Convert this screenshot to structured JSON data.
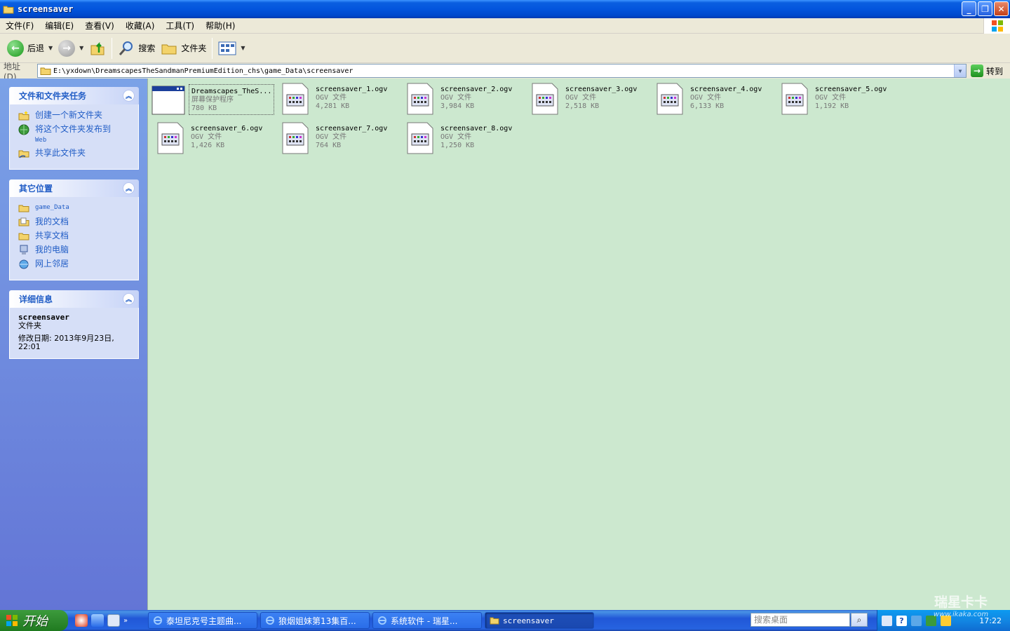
{
  "window": {
    "title": "screensaver",
    "icon": "folder-icon"
  },
  "menu": [
    "文件(F)",
    "编辑(E)",
    "查看(V)",
    "收藏(A)",
    "工具(T)",
    "帮助(H)"
  ],
  "toolbar": {
    "back_label": "后退",
    "search_label": "搜索",
    "folders_label": "文件夹"
  },
  "address": {
    "label": "地址(D)",
    "path": "E:\\yxdown\\DreamscapesTheSandmanPremiumEdition_chs\\game_Data\\screensaver",
    "go_label": "转到"
  },
  "tasks_panel": {
    "title": "文件和文件夹任务",
    "items": [
      {
        "label": "创建一个新文件夹",
        "icon": "new-folder-icon"
      },
      {
        "label": "将这个文件夹发布到",
        "label2": "Web",
        "icon": "publish-web-icon"
      },
      {
        "label": "共享此文件夹",
        "icon": "share-folder-icon"
      }
    ]
  },
  "places_panel": {
    "title": "其它位置",
    "items": [
      {
        "label": "game_Data",
        "icon": "folder-icon"
      },
      {
        "label": "我的文档",
        "icon": "my-documents-icon"
      },
      {
        "label": "共享文档",
        "icon": "shared-documents-icon"
      },
      {
        "label": "我的电脑",
        "icon": "my-computer-icon"
      },
      {
        "label": "网上邻居",
        "icon": "network-places-icon"
      }
    ]
  },
  "details_panel": {
    "title": "详细信息",
    "name": "screensaver",
    "type": "文件夹",
    "modified_line1": "修改日期: 2013年9月23日,",
    "modified_line2": "22:01"
  },
  "files": [
    {
      "name": "Dreamscapes_TheS...",
      "type": "屏幕保护程序",
      "size": "780 KB",
      "icon": "screensaver-icon",
      "selected": true
    },
    {
      "name": "screensaver_1.ogv",
      "type": "OGV 文件",
      "size": "4,281 KB",
      "icon": "media-file-icon"
    },
    {
      "name": "screensaver_2.ogv",
      "type": "OGV 文件",
      "size": "3,984 KB",
      "icon": "media-file-icon"
    },
    {
      "name": "screensaver_3.ogv",
      "type": "OGV 文件",
      "size": "2,518 KB",
      "icon": "media-file-icon"
    },
    {
      "name": "screensaver_4.ogv",
      "type": "OGV 文件",
      "size": "6,133 KB",
      "icon": "media-file-icon"
    },
    {
      "name": "screensaver_5.ogv",
      "type": "OGV 文件",
      "size": "1,192 KB",
      "icon": "media-file-icon"
    },
    {
      "name": "screensaver_6.ogv",
      "type": "OGV 文件",
      "size": "1,426 KB",
      "icon": "media-file-icon"
    },
    {
      "name": "screensaver_7.ogv",
      "type": "OGV 文件",
      "size": "764 KB",
      "icon": "media-file-icon"
    },
    {
      "name": "screensaver_8.ogv",
      "type": "OGV 文件",
      "size": "1,250 KB",
      "icon": "media-file-icon"
    }
  ],
  "taskbar": {
    "start_label": "开始",
    "tasks": [
      {
        "label": "泰坦尼克号主题曲...",
        "icon": "ie-icon"
      },
      {
        "label": "狼烟姐妹第13集百...",
        "icon": "ie-icon"
      },
      {
        "label": "系统软件 - 瑞星...",
        "icon": "ie-icon"
      },
      {
        "label": "screensaver",
        "icon": "folder-icon",
        "active": true
      }
    ],
    "desk_search_placeholder": "搜索桌面",
    "clock": "17:22"
  },
  "watermark": {
    "line1": "瑞星卡卡",
    "line2": "www.ikaka.com"
  },
  "colors": {
    "titlebar": "#0355dd",
    "leftpane": "#6f8fe0",
    "content_bg": "#cce8cf",
    "link": "#215dc6",
    "taskbar": "#2157d7",
    "start": "#2f8a2f"
  }
}
